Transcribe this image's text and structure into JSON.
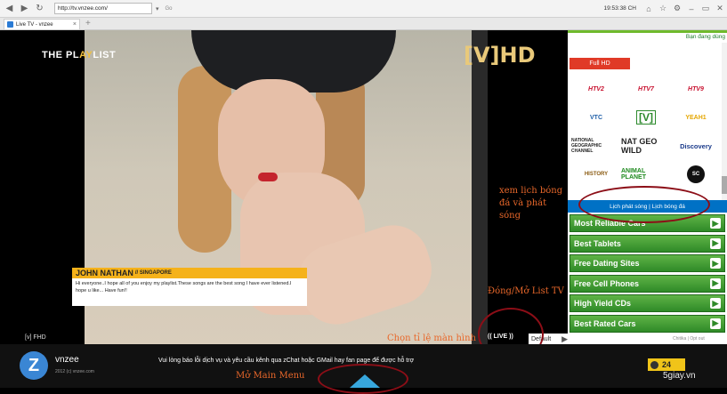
{
  "browser": {
    "url": "http://tv.vnzee.com/",
    "go_label": "Go",
    "time": "19:53:38 CH",
    "tab_title": "Live TV - vnzee",
    "icons": [
      "back-icon",
      "forward-icon",
      "reload-icon",
      "home-icon",
      "star-icon",
      "gear-icon"
    ]
  },
  "video": {
    "show_logo_pre": "THE PL",
    "show_logo_accent": "AY",
    "show_logo_post": "LIST",
    "channel_logo": "[V]HD",
    "lower_third_name": "JOHN NATHAN",
    "lower_third_location": "// SINGAPORE",
    "lower_third_message": "Hi everyone..I hope all of you enjoy my playlist.These songs are the best song I have ever listened.I hope u like... Have fun!!",
    "channel_label": "[v] FHD",
    "live_label": "(( LIVE ))",
    "ratio_value": "Default"
  },
  "annotations": {
    "schedule": "xem lịch bóng đá và phát sóng",
    "toggle_list": "Đóng/Mở List TV",
    "aspect_ratio": "Chọn tỉ lệ màn hình",
    "main_menu": "Mở Main Menu"
  },
  "sidebar": {
    "top_text": "Bạn đang dùng",
    "fullhd_label": "Full HD",
    "channels": [
      "HTV2",
      "HTV7",
      "HTV9",
      "VTC",
      "[V]",
      "YEAH1",
      "NATIONAL GEOGRAPHIC CHANNEL",
      "NAT GEO WILD",
      "Discovery",
      "HISTORY",
      "ANIMAL PLANET",
      "SC"
    ],
    "schedule_link": "Lịch phát sóng | Lịch bóng đá",
    "ads": [
      "Most Reliable Cars",
      "Best Tablets",
      "Free Dating Sites",
      "Free Cell Phones",
      "High Yield CDs",
      "Best Rated Cars"
    ],
    "adchoices": "Chitika | Opt out"
  },
  "footer": {
    "brand": "vnzee",
    "copyright": "2012 (c) vnzee.com",
    "notice": "Vui lòng báo lỗi dịch vụ và yêu cầu kênh qua zChat hoặc GMail hay fan page để được hỗ trợ",
    "badge_value": "24",
    "watermark": "5giay.vn"
  },
  "colors": {
    "annotation": "#e8672a",
    "ellipse": "#8c0e17",
    "ad_green": "#2f8a28",
    "schedule_blue": "#0071c5",
    "menu_arrow": "#37a7dd"
  }
}
